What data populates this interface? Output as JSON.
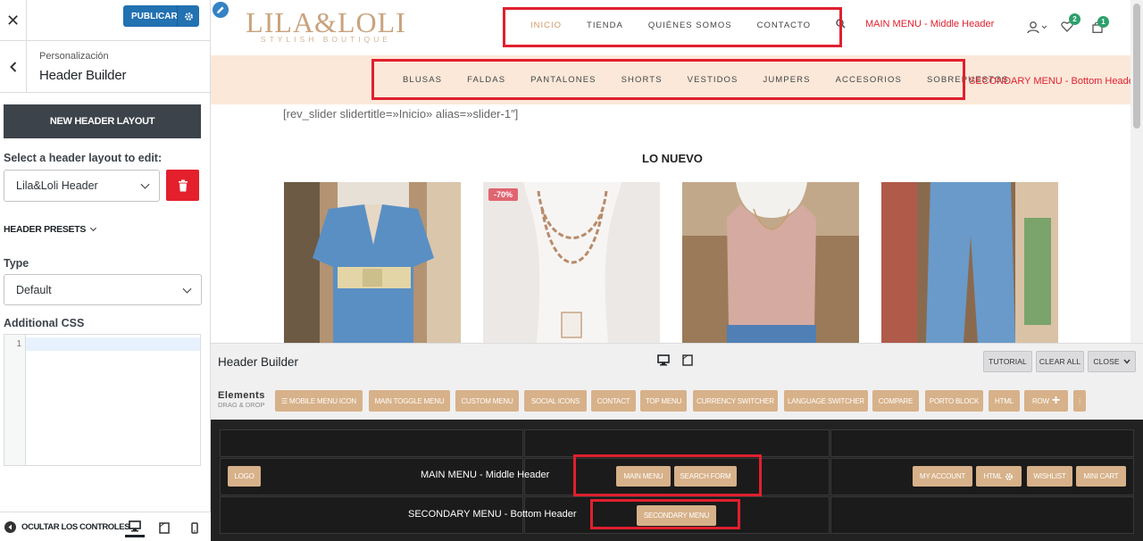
{
  "left_panel": {
    "publish_label": "PUBLICAR",
    "section_sub": "Personalización",
    "section_title": "Header Builder",
    "new_layout_label": "NEW HEADER LAYOUT",
    "select_layout_label": "Select a header layout to edit:",
    "selected_layout": "Lila&Loli Header",
    "presets_label": "HEADER PRESETS",
    "type_label": "Type",
    "type_value": "Default",
    "css_label": "Additional CSS",
    "css_line_number": "1",
    "hide_controls_label": "OCULTAR LOS CONTROLES"
  },
  "preview": {
    "logo_line1": "LILA&LOLI",
    "logo_line2": "STYLISH BOUTIQUE",
    "main_menu": [
      "INICIO",
      "TIENDA",
      "QUIÉNES SOMOS",
      "CONTACTO"
    ],
    "main_menu_annotation": "MAIN MENU - Middle Header",
    "wishlist_count": "2",
    "cart_count": "1",
    "secondary_menu": [
      "BLUSAS",
      "FALDAS",
      "PANTALONES",
      "SHORTS",
      "VESTIDOS",
      "JUMPERS",
      "ACCESORIOS",
      "SOBREPUESTOS"
    ],
    "secondary_menu_annotation": "SECONDARY  MENU - Bottom Header",
    "rev_slider_text": "[rev_slider slidertitle=»Inicio» alias=»slider-1″]",
    "new_heading": "LO NUEVO",
    "sale_badge": "-70%"
  },
  "builder": {
    "title": "Header Builder",
    "tutorial_label": "TUTORIAL",
    "clear_all_label": "CLEAR ALL",
    "close_label": "CLOSE",
    "elements_label": "Elements",
    "drag_drop_label": "DRAG & DROP",
    "elements": [
      "☰ MOBILE MENU ICON",
      "MAIN TOGGLE MENU",
      "CUSTOM MENU",
      "SOCIAL ICONS",
      "CONTACT",
      "TOP MENU",
      "CURRENCY SWITCHER",
      "LANGUAGE SWITCHER",
      "COMPARE",
      "PORTO BLOCK",
      "HTML",
      "ROW"
    ],
    "more_label": "⋮"
  },
  "canvas": {
    "logo_chip": "LOGO",
    "middle_row_label": "MAIN MENU - Middle Header",
    "bottom_row_label": "SECONDARY MENU - Bottom Header",
    "main_menu_chip": "MAIN MENU",
    "search_form_chip": "SEARCH FORM",
    "secondary_menu_chip": "SECONDARY MENU",
    "my_account_chip": "MY ACCOUNT",
    "html_chip": "HTML",
    "wishlist_chip": "WISHLIST",
    "mini_cart_chip": "MINI CART"
  },
  "colors": {
    "publish_blue": "#2271b1",
    "delete_red": "#e3202c",
    "annotation_red": "#e0202e",
    "chip_tan": "#d7b189",
    "bottom_band": "#fbe8d9"
  }
}
